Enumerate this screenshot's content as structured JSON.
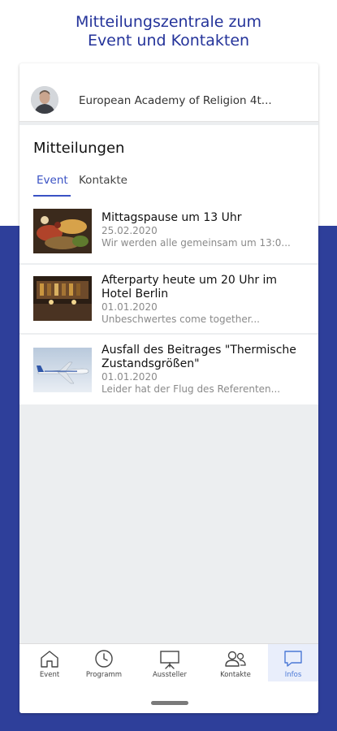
{
  "headline": {
    "line1": "Mitteilungszentrale zum",
    "line2": "Event und Kontakten"
  },
  "event": {
    "name": "European Academy of Religion 4t..."
  },
  "messages_panel": {
    "title": "Mitteilungen",
    "tabs": [
      {
        "label": "Event",
        "active": true
      },
      {
        "label": "Kontakte",
        "active": false
      }
    ]
  },
  "messages": [
    {
      "title": "Mittagspause um 13 Uhr",
      "date": "25.02.2020",
      "preview": "Wir werden alle gemeinsam um 13:0...",
      "image": "buffet-food-photo"
    },
    {
      "title": "Afterparty heute um 20 Uhr im Hotel Berlin",
      "date": "01.01.2020",
      "preview": "Unbeschwertes come together...",
      "image": "bar-interior-photo"
    },
    {
      "title": "Ausfall des Beitrages \"Thermische Zustandsgrößen\"",
      "date": "01.01.2020",
      "preview": "Leider hat der Flug des Referenten...",
      "image": "airplane-photo"
    }
  ],
  "tabbar": {
    "items": [
      {
        "label": "Event",
        "icon": "home-icon",
        "active": false
      },
      {
        "label": "Programm",
        "icon": "clock-icon",
        "active": false
      },
      {
        "label": "Aussteller",
        "icon": "presentation-board-icon",
        "active": false
      },
      {
        "label": "Kontakte",
        "icon": "contacts-icon",
        "active": false
      },
      {
        "label": "Infos",
        "icon": "chat-bubble-icon",
        "active": true
      }
    ]
  },
  "colors": {
    "brand": "#2e3f9a",
    "headline": "#24339a",
    "accent": "#3a52c4",
    "active_tab_bg": "#e9eefb"
  }
}
